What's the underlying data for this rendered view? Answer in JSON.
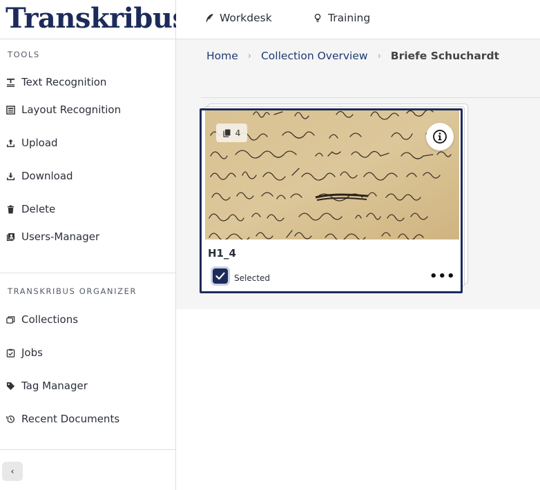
{
  "brand": {
    "logo_text": "Transkribus",
    "registered": "®"
  },
  "sidebar": {
    "tools_title": "TOOLS",
    "tools": [
      {
        "label": "Text Recognition",
        "icon": "text-recognition-icon"
      },
      {
        "label": "Layout Recognition",
        "icon": "layout-recognition-icon"
      },
      {
        "label": "Upload",
        "icon": "upload-icon"
      },
      {
        "label": "Download",
        "icon": "download-icon"
      },
      {
        "label": "Delete",
        "icon": "trash-icon"
      },
      {
        "label": "Users-Manager",
        "icon": "users-manager-icon"
      }
    ],
    "organizer_title": "TRANSKRIBUS ORGANIZER",
    "organizer": [
      {
        "label": "Collections",
        "icon": "collections-icon"
      },
      {
        "label": "Jobs",
        "icon": "jobs-icon"
      },
      {
        "label": "Tag Manager",
        "icon": "tag-icon"
      },
      {
        "label": "Recent Documents",
        "icon": "history-icon"
      }
    ],
    "collapse_label": "‹"
  },
  "topbar": {
    "links": [
      {
        "label": "Workdesk",
        "icon": "feather-icon"
      },
      {
        "label": "Training",
        "icon": "lightbulb-icon"
      }
    ]
  },
  "breadcrumb": {
    "items": [
      "Home",
      "Collection Overview"
    ],
    "current": "Briefe Schuchardt",
    "separator": "›"
  },
  "document_card": {
    "page_count": "4",
    "title": "H1_4",
    "selected_label": "Selected",
    "more_label": "•••",
    "selected": true
  },
  "colors": {
    "brand_navy": "#1c2b5a",
    "link_blue": "#1c3a73",
    "main_bg": "#f5f5f5",
    "paper": "#d7c093"
  }
}
